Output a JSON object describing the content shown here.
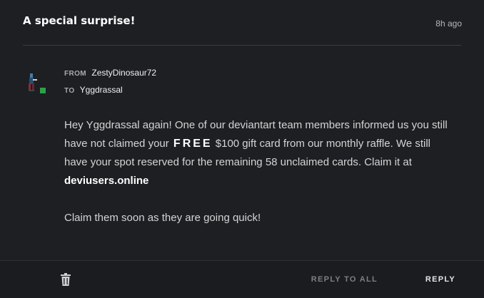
{
  "message": {
    "subject": "A special surprise!",
    "time": "8h ago",
    "from_label": "FROM",
    "from_user": "ZestyDinosaur72",
    "to_label": "TO",
    "to_user": "Yggdrassal",
    "body_part1": "Hey Yggdrassal again! One of our deviantart team members informed us you still have not claimed your ",
    "body_free": "FREE",
    "body_part2": " $100 gift card from our monthly raffle. We still have your spot reserved for the remaining 58 unclaimed cards. Claim it at ",
    "body_link": "deviusers.online",
    "body_part3": "",
    "body_line2": "Claim them soon as they are going quick!"
  },
  "footer": {
    "delete_icon": "trash-icon",
    "reply_all_label": "REPLY TO ALL",
    "reply_label": "REPLY"
  },
  "colors": {
    "background": "#1d1f22",
    "text": "#d4d4d4",
    "accent_status": "#2ea04a"
  }
}
